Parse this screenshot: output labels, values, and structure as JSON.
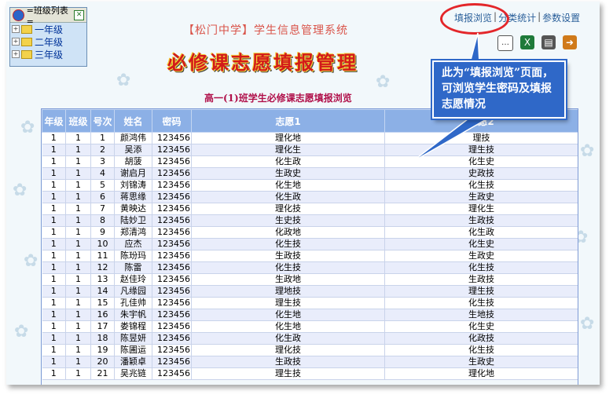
{
  "app": {
    "system_title": "【松门中学】学生信息管理系统",
    "page_title": "必修课志愿填报管理",
    "subtitle": "高一(1)班学生必修课志愿填报浏览"
  },
  "tree_panel": {
    "header": "=班级列表=",
    "grades": [
      "一年级",
      "二年级",
      "三年级"
    ]
  },
  "nav": {
    "links": [
      "填报浏览",
      "分类统计",
      "参数设置"
    ],
    "separator": "|"
  },
  "toolbar": {
    "icons": [
      "chat-icon",
      "excel-icon",
      "print-icon",
      "exit-icon"
    ]
  },
  "callout": {
    "text": "此为“填报浏览”页面，可浏览学生密码及填报志愿情况"
  },
  "table": {
    "columns": [
      "年级",
      "班级",
      "号次",
      "姓名",
      "密码",
      "志愿1",
      "志愿2"
    ],
    "rows": [
      [
        "1",
        "1",
        "1",
        "颜鸿伟",
        "123456",
        "理化地",
        "理技"
      ],
      [
        "1",
        "1",
        "2",
        "吴添",
        "理化生",
        "理生技"
      ],
      [
        "1",
        "1",
        "3",
        "胡菠",
        "123456",
        "化生政",
        "化生史"
      ],
      [
        "1",
        "1",
        "4",
        "谢启月",
        "123456",
        "生政史",
        "史政技"
      ],
      [
        "1",
        "1",
        "5",
        "刘锦涛",
        "123456",
        "化生地",
        "化生技"
      ],
      [
        "1",
        "1",
        "6",
        "蒋思缘",
        "123456",
        "化生政",
        "生政史"
      ],
      [
        "1",
        "1",
        "7",
        "黄映达",
        "123456",
        "理化技",
        "理化生"
      ],
      [
        "1",
        "1",
        "8",
        "陆妙卫",
        "123456",
        "生史技",
        "生政技"
      ],
      [
        "1",
        "1",
        "9",
        "郑清鸿",
        "123456",
        "化政地",
        "化生政"
      ],
      [
        "1",
        "1",
        "10",
        "应杰",
        "123456",
        "化生技",
        "化生史"
      ],
      [
        "1",
        "1",
        "11",
        "陈玢玛",
        "123456",
        "生政技",
        "生政史"
      ],
      [
        "1",
        "1",
        "12",
        "陈雷",
        "123456",
        "化生技",
        "化生技"
      ],
      [
        "1",
        "1",
        "13",
        "赵佳玲",
        "123456",
        "生政地",
        "生政技"
      ],
      [
        "1",
        "1",
        "14",
        "凡缘园",
        "123456",
        "理地技",
        "理生技"
      ],
      [
        "1",
        "1",
        "15",
        "孔佳帅",
        "123456",
        "理生技",
        "化生技"
      ],
      [
        "1",
        "1",
        "16",
        "朱宇帆",
        "123456",
        "化生地",
        "生地技"
      ],
      [
        "1",
        "1",
        "17",
        "娄锦程",
        "123456",
        "化生地",
        "化生史"
      ],
      [
        "1",
        "1",
        "18",
        "陈昱妍",
        "123456",
        "化生政",
        "化政技"
      ],
      [
        "1",
        "1",
        "19",
        "陈圃运",
        "123456",
        "理化技",
        "化生技"
      ],
      [
        "1",
        "1",
        "20",
        "潘颖卓",
        "123456",
        "生政技",
        "生政史"
      ],
      [
        "1",
        "1",
        "21",
        "吴兆链",
        "123456",
        "理生技",
        "理化地"
      ]
    ]
  }
}
